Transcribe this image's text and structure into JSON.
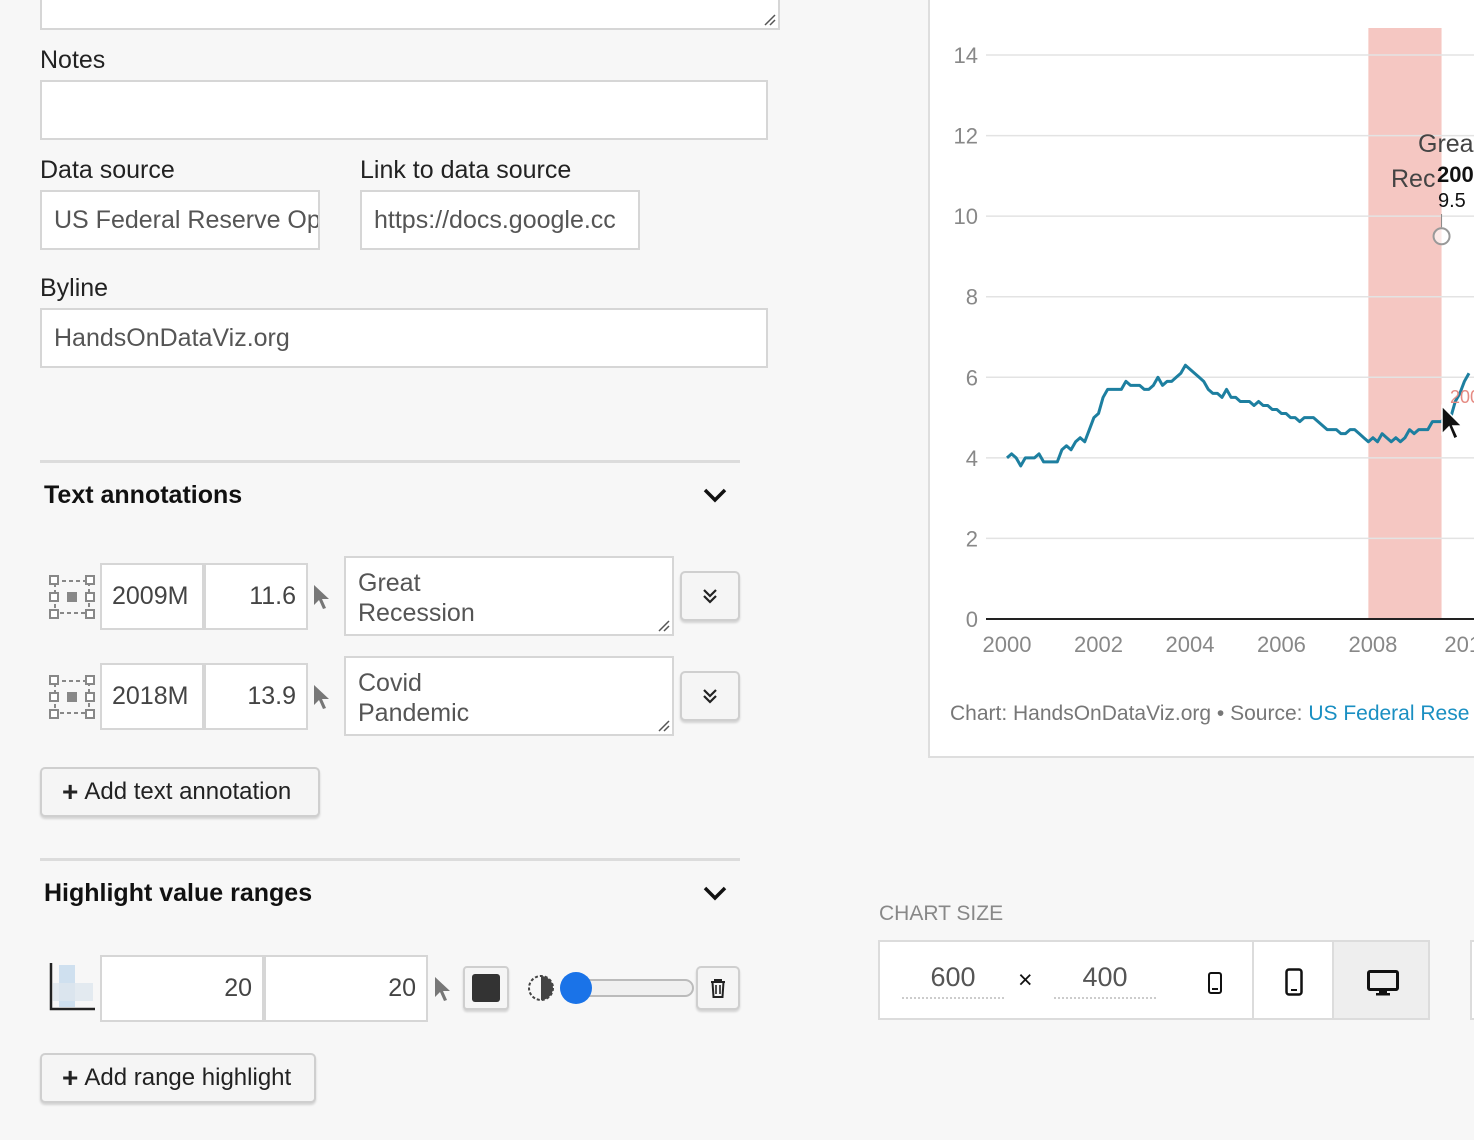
{
  "form": {
    "notes_label": "Notes",
    "notes_value": "",
    "data_source_label": "Data source",
    "data_source_value": "US Federal Reserve Op",
    "link_label": "Link to data source",
    "link_value": "https://docs.google.cc",
    "byline_label": "Byline",
    "byline_value": "HandsOnDataViz.org"
  },
  "text_annotations": {
    "title": "Text annotations",
    "items": [
      {
        "x": "2009M",
        "y": "11.6",
        "text_line1": "Great",
        "text_line2": "Recession"
      },
      {
        "x": "2018M",
        "y": "13.9",
        "text_line1": "Covid",
        "text_line2": "Pandemic"
      }
    ],
    "add_label": "Add text annotation"
  },
  "highlight_ranges": {
    "title": "Highlight value ranges",
    "items": [
      {
        "from": "20",
        "to": "20",
        "color": "#333333",
        "opacity": 0.1
      }
    ],
    "add_label": "Add range highlight"
  },
  "chart_size": {
    "title": "CHART SIZE",
    "width": "600",
    "times": "×",
    "height": "400",
    "modes": [
      "mobile-small",
      "mobile",
      "desktop"
    ],
    "active_mode": "desktop"
  },
  "chart_data": {
    "type": "line",
    "title": "",
    "xlabel": "",
    "ylabel": "",
    "xlim": [
      2000,
      2010.1
    ],
    "ylim": [
      0,
      14
    ],
    "x_ticks": [
      "2000",
      "2002",
      "2004",
      "2006",
      "2008",
      "201"
    ],
    "y_ticks": [
      "0",
      "2",
      "4",
      "6",
      "8",
      "10",
      "12",
      "14"
    ],
    "grid": true,
    "line_color": "#1d7fa0",
    "highlight": {
      "from": 2007.9,
      "to": 2009.5,
      "color": "#f5c7c2"
    },
    "annotation": {
      "line1": "Grea",
      "line2": "Rec",
      "bold": "200",
      "value": "9.5",
      "marker_x": 2009.5,
      "marker_y": 9.5
    },
    "side_label": "200",
    "credit_prefix": "Chart: HandsOnDataViz.org • Source: ",
    "credit_link": "US Federal Rese",
    "series": [
      {
        "values": [
          [
            2000.0,
            4.0
          ],
          [
            2000.1,
            4.1
          ],
          [
            2000.2,
            4.0
          ],
          [
            2000.3,
            3.8
          ],
          [
            2000.4,
            4.0
          ],
          [
            2000.5,
            4.0
          ],
          [
            2000.6,
            4.0
          ],
          [
            2000.7,
            4.1
          ],
          [
            2000.8,
            3.9
          ],
          [
            2000.9,
            3.9
          ],
          [
            2001.0,
            3.9
          ],
          [
            2001.1,
            3.9
          ],
          [
            2001.2,
            4.2
          ],
          [
            2001.3,
            4.3
          ],
          [
            2001.4,
            4.2
          ],
          [
            2001.5,
            4.4
          ],
          [
            2001.6,
            4.5
          ],
          [
            2001.7,
            4.4
          ],
          [
            2001.8,
            4.7
          ],
          [
            2001.9,
            5.0
          ],
          [
            2002.0,
            5.1
          ],
          [
            2002.1,
            5.5
          ],
          [
            2002.2,
            5.7
          ],
          [
            2002.3,
            5.7
          ],
          [
            2002.4,
            5.7
          ],
          [
            2002.5,
            5.7
          ],
          [
            2002.6,
            5.9
          ],
          [
            2002.7,
            5.8
          ],
          [
            2002.8,
            5.8
          ],
          [
            2002.9,
            5.8
          ],
          [
            2003.0,
            5.7
          ],
          [
            2003.1,
            5.7
          ],
          [
            2003.2,
            5.8
          ],
          [
            2003.3,
            6.0
          ],
          [
            2003.4,
            5.8
          ],
          [
            2003.5,
            5.9
          ],
          [
            2003.6,
            5.9
          ],
          [
            2003.7,
            6.0
          ],
          [
            2003.8,
            6.1
          ],
          [
            2003.9,
            6.3
          ],
          [
            2004.0,
            6.2
          ],
          [
            2004.1,
            6.1
          ],
          [
            2004.2,
            6.0
          ],
          [
            2004.3,
            5.9
          ],
          [
            2004.4,
            5.7
          ],
          [
            2004.5,
            5.6
          ],
          [
            2004.6,
            5.6
          ],
          [
            2004.7,
            5.5
          ],
          [
            2004.8,
            5.7
          ],
          [
            2004.9,
            5.5
          ],
          [
            2005.0,
            5.5
          ],
          [
            2005.1,
            5.4
          ],
          [
            2005.2,
            5.4
          ],
          [
            2005.3,
            5.4
          ],
          [
            2005.4,
            5.3
          ],
          [
            2005.5,
            5.4
          ],
          [
            2005.6,
            5.3
          ],
          [
            2005.7,
            5.3
          ],
          [
            2005.8,
            5.2
          ],
          [
            2005.9,
            5.2
          ],
          [
            2006.0,
            5.1
          ],
          [
            2006.1,
            5.1
          ],
          [
            2006.2,
            5.0
          ],
          [
            2006.3,
            5.0
          ],
          [
            2006.4,
            4.9
          ],
          [
            2006.5,
            5.0
          ],
          [
            2006.6,
            5.0
          ],
          [
            2006.7,
            5.0
          ],
          [
            2006.8,
            4.9
          ],
          [
            2006.9,
            4.8
          ],
          [
            2007.0,
            4.7
          ],
          [
            2007.1,
            4.7
          ],
          [
            2007.2,
            4.7
          ],
          [
            2007.3,
            4.6
          ],
          [
            2007.4,
            4.6
          ],
          [
            2007.5,
            4.7
          ],
          [
            2007.6,
            4.7
          ],
          [
            2007.7,
            4.6
          ],
          [
            2007.8,
            4.5
          ],
          [
            2007.9,
            4.4
          ],
          [
            2008.0,
            4.5
          ],
          [
            2008.1,
            4.4
          ],
          [
            2008.2,
            4.6
          ],
          [
            2008.3,
            4.5
          ],
          [
            2008.4,
            4.4
          ],
          [
            2008.5,
            4.5
          ],
          [
            2008.6,
            4.4
          ],
          [
            2008.7,
            4.5
          ],
          [
            2008.8,
            4.7
          ],
          [
            2008.9,
            4.6
          ],
          [
            2009.0,
            4.7
          ],
          [
            2009.1,
            4.7
          ],
          [
            2009.2,
            4.7
          ],
          [
            2009.3,
            4.9
          ],
          [
            2009.4,
            4.9
          ],
          [
            2009.5,
            4.9
          ],
          [
            2009.6,
            5.1
          ],
          [
            2009.7,
            5.0
          ],
          [
            2009.8,
            5.4
          ],
          [
            2009.9,
            5.6
          ],
          [
            2010.0,
            5.9
          ],
          [
            2010.1,
            6.1
          ]
        ]
      }
    ]
  }
}
